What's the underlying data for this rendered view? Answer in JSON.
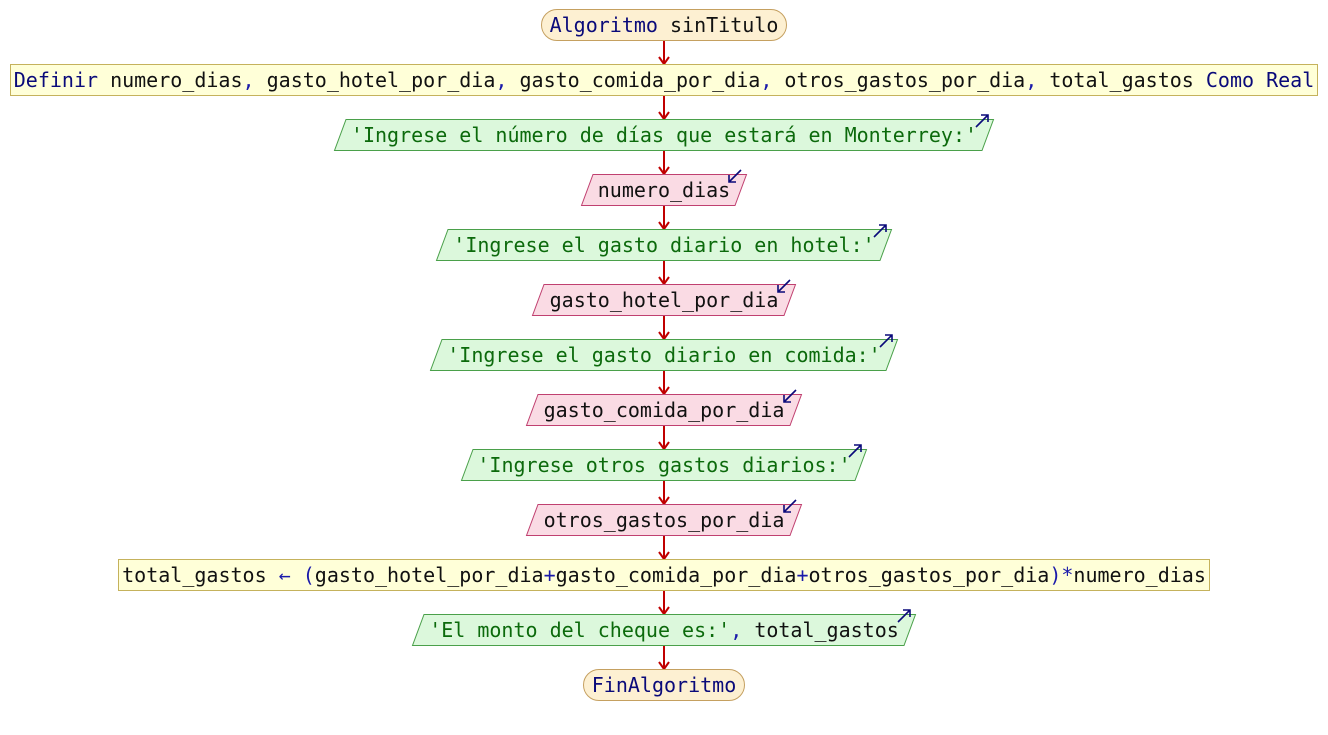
{
  "colors": {
    "arrow": "#c00000",
    "terminator_fill": "#fdf0d2",
    "process_fill": "#ffffd8",
    "output_fill": "#dcf8dc",
    "output_stroke": "#4aa04a",
    "input_fill": "#fadbe4",
    "input_stroke": "#c04070",
    "io_indicator": "#0a0a7a",
    "keyword": "#0a0a7a",
    "string": "#0c6a0c",
    "variable": "#111111"
  },
  "nodes": [
    {
      "id": "start",
      "type": "terminator",
      "parts": [
        {
          "k": "kw",
          "t": "Algoritmo "
        },
        {
          "k": "vr",
          "t": "sinTitulo"
        }
      ]
    },
    {
      "id": "define",
      "type": "process",
      "parts": [
        {
          "k": "kw",
          "t": "Definir "
        },
        {
          "k": "vr",
          "t": "numero_dias"
        },
        {
          "k": "op",
          "t": ", "
        },
        {
          "k": "vr",
          "t": "gasto_hotel_por_dia"
        },
        {
          "k": "op",
          "t": ", "
        },
        {
          "k": "vr",
          "t": "gasto_comida_por_dia"
        },
        {
          "k": "op",
          "t": ", "
        },
        {
          "k": "vr",
          "t": "otros_gastos_por_dia"
        },
        {
          "k": "op",
          "t": ", "
        },
        {
          "k": "vr",
          "t": "total_gastos"
        },
        {
          "k": "kw",
          "t": " Como Real"
        }
      ]
    },
    {
      "id": "out1",
      "type": "output",
      "parts": [
        {
          "k": "st",
          "t": "'Ingrese el número de días que estará en Monterrey:'"
        }
      ]
    },
    {
      "id": "in1",
      "type": "input",
      "parts": [
        {
          "k": "vr",
          "t": "numero_dias"
        }
      ]
    },
    {
      "id": "out2",
      "type": "output",
      "parts": [
        {
          "k": "st",
          "t": "'Ingrese el gasto diario en hotel:'"
        }
      ]
    },
    {
      "id": "in2",
      "type": "input",
      "parts": [
        {
          "k": "vr",
          "t": "gasto_hotel_por_dia"
        }
      ]
    },
    {
      "id": "out3",
      "type": "output",
      "parts": [
        {
          "k": "st",
          "t": "'Ingrese el gasto diario en comida:'"
        }
      ]
    },
    {
      "id": "in3",
      "type": "input",
      "parts": [
        {
          "k": "vr",
          "t": "gasto_comida_por_dia"
        }
      ]
    },
    {
      "id": "out4",
      "type": "output",
      "parts": [
        {
          "k": "st",
          "t": "'Ingrese otros gastos diarios:'"
        }
      ]
    },
    {
      "id": "in4",
      "type": "input",
      "parts": [
        {
          "k": "vr",
          "t": "otros_gastos_por_dia"
        }
      ]
    },
    {
      "id": "assign",
      "type": "process",
      "parts": [
        {
          "k": "vr",
          "t": "total_gastos"
        },
        {
          "k": "op",
          "t": " ← ("
        },
        {
          "k": "vr",
          "t": "gasto_hotel_por_dia"
        },
        {
          "k": "op",
          "t": "+"
        },
        {
          "k": "vr",
          "t": "gasto_comida_por_dia"
        },
        {
          "k": "op",
          "t": "+"
        },
        {
          "k": "vr",
          "t": "otros_gastos_por_dia"
        },
        {
          "k": "op",
          "t": ")*"
        },
        {
          "k": "vr",
          "t": "numero_dias"
        }
      ]
    },
    {
      "id": "out5",
      "type": "output",
      "parts": [
        {
          "k": "st",
          "t": "'El monto del cheque es:'"
        },
        {
          "k": "op",
          "t": ", "
        },
        {
          "k": "vr",
          "t": "total_gastos"
        }
      ]
    },
    {
      "id": "end",
      "type": "terminator",
      "parts": [
        {
          "k": "kw",
          "t": "FinAlgoritmo"
        }
      ]
    }
  ]
}
